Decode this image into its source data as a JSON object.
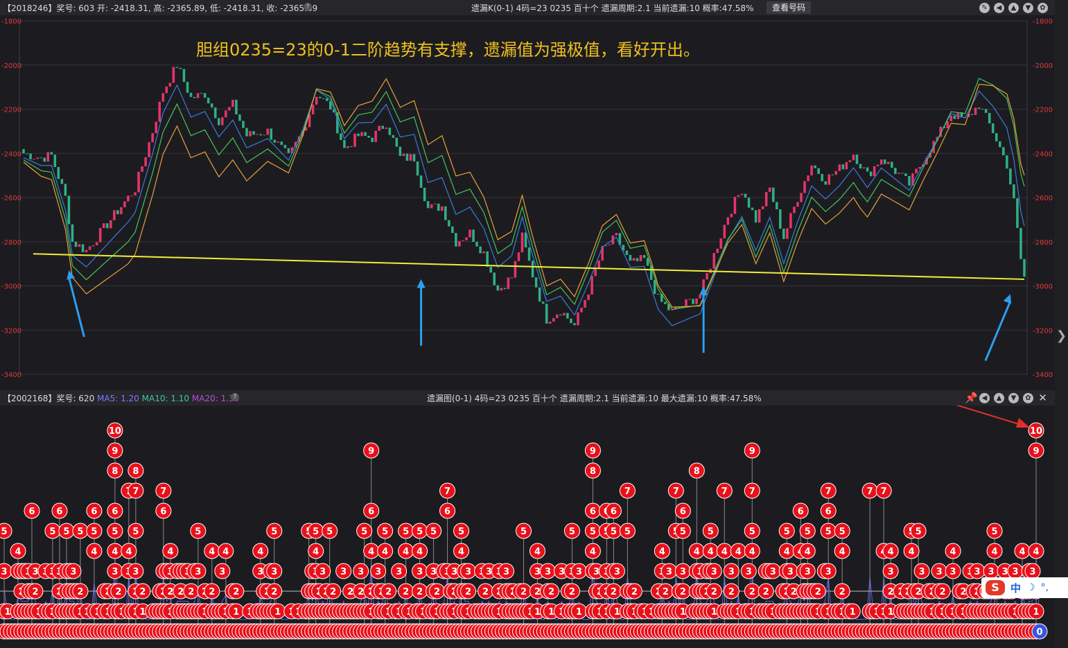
{
  "top_bar": {
    "info_left": "【2018246】奖号: 603  开: -2418.31, 高: -2365.89, 低: -2418.31, 收: -2365.89",
    "info_center": "遗漏K(0-1)  4码=23  0235  百十个  遗漏周期:2.1  当前遗漏:10  概率:47.58%",
    "query_button": "查看号码"
  },
  "bottom_bar": {
    "id_label": "【2002168】奖号: 620",
    "ma5": "MA5: 1.20",
    "ma10": "MA10: 1.10",
    "ma20": "MA20: 1.30",
    "info_center": "遗漏图(0-1)  4码=23  0235  百十个  遗漏周期:2.1  当前遗漏:10  最大遗漏:10  概率:47.58%"
  },
  "annotation": "胆组0235=23的0-1二阶趋势有支撑，遗漏值为强极值，看好开出。",
  "ime": {
    "zh": "中",
    "moon": "☽",
    "punct": "°,"
  },
  "colors": {
    "up": "#e8336b",
    "down": "#2fb084",
    "ma_blue": "#3a7be0",
    "ma_green": "#46c45a",
    "ma_orange": "#e7a23a",
    "support": "#f2ee3a",
    "arrow": "#2aa0f0",
    "red_arrow": "#e0302a",
    "ball": "#e8101a",
    "ball_last": "#3a56e0",
    "title": "#f0c020"
  },
  "chart_data": [
    {
      "type": "candlestick",
      "title": "",
      "ylim": [
        -3400,
        -1800
      ],
      "y_ticks": [
        "-1800",
        "-2000",
        "-2200",
        "-2400",
        "-2600",
        "-2800",
        "-3000",
        "-3200",
        "-3400"
      ],
      "close_path": [
        [
          0,
          -2400
        ],
        [
          5,
          -2420
        ],
        [
          8,
          -2410
        ],
        [
          12,
          -2600
        ],
        [
          14,
          -2800
        ],
        [
          18,
          -2840
        ],
        [
          22,
          -2760
        ],
        [
          28,
          -2640
        ],
        [
          32,
          -2560
        ],
        [
          37,
          -2300
        ],
        [
          40,
          -2120
        ],
        [
          44,
          -2000
        ],
        [
          48,
          -2150
        ],
        [
          52,
          -2130
        ],
        [
          56,
          -2250
        ],
        [
          60,
          -2180
        ],
        [
          64,
          -2320
        ],
        [
          70,
          -2300
        ],
        [
          76,
          -2420
        ],
        [
          80,
          -2300
        ],
        [
          84,
          -2130
        ],
        [
          88,
          -2190
        ],
        [
          92,
          -2380
        ],
        [
          96,
          -2320
        ],
        [
          100,
          -2330
        ],
        [
          104,
          -2260
        ],
        [
          108,
          -2420
        ],
        [
          112,
          -2420
        ],
        [
          116,
          -2650
        ],
        [
          120,
          -2640
        ],
        [
          124,
          -2800
        ],
        [
          128,
          -2760
        ],
        [
          132,
          -2850
        ],
        [
          136,
          -3020
        ],
        [
          140,
          -2960
        ],
        [
          143,
          -2780
        ],
        [
          146,
          -2950
        ],
        [
          150,
          -3150
        ],
        [
          154,
          -3110
        ],
        [
          158,
          -3180
        ],
        [
          162,
          -3020
        ],
        [
          166,
          -2840
        ],
        [
          170,
          -2780
        ],
        [
          174,
          -2900
        ],
        [
          178,
          -2880
        ],
        [
          182,
          -3060
        ],
        [
          186,
          -3120
        ],
        [
          190,
          -3080
        ],
        [
          194,
          -3040
        ],
        [
          198,
          -2860
        ],
        [
          202,
          -2680
        ],
        [
          206,
          -2560
        ],
        [
          210,
          -2700
        ],
        [
          214,
          -2560
        ],
        [
          218,
          -2780
        ],
        [
          222,
          -2600
        ],
        [
          226,
          -2450
        ],
        [
          230,
          -2520
        ],
        [
          234,
          -2470
        ],
        [
          238,
          -2400
        ],
        [
          242,
          -2500
        ],
        [
          246,
          -2420
        ],
        [
          250,
          -2480
        ],
        [
          254,
          -2540
        ],
        [
          258,
          -2430
        ],
        [
          262,
          -2330
        ],
        [
          266,
          -2220
        ],
        [
          270,
          -2250
        ],
        [
          274,
          -2180
        ],
        [
          278,
          -2300
        ],
        [
          282,
          -2450
        ],
        [
          284,
          -2620
        ],
        [
          286,
          -2880
        ],
        [
          287,
          -2960
        ]
      ],
      "moving_averages": [
        {
          "name": "MA5",
          "offsets": [
            [
              0,
              -20
            ],
            [
              30,
              -110
            ],
            [
              60,
              -70
            ],
            [
              90,
              40
            ],
            [
              120,
              130
            ],
            [
              150,
              80
            ],
            [
              180,
              -40
            ],
            [
              210,
              -140
            ],
            [
              240,
              -60
            ],
            [
              270,
              10
            ],
            [
              287,
              230
            ]
          ]
        },
        {
          "name": "MA10",
          "offsets": [
            [
              0,
              -30
            ],
            [
              30,
              -200
            ],
            [
              60,
              -150
            ],
            [
              90,
              60
            ],
            [
              120,
              230
            ],
            [
              150,
              110
            ],
            [
              180,
              60
            ],
            [
              210,
              -170
            ],
            [
              240,
              -130
            ],
            [
              270,
              30
            ],
            [
              287,
              410
            ]
          ]
        },
        {
          "name": "MA20",
          "offsets": [
            [
              0,
              -40
            ],
            [
              30,
              -300
            ],
            [
              60,
              -250
            ],
            [
              90,
              90
            ],
            [
              120,
              320
            ],
            [
              150,
              150
            ],
            [
              180,
              80
            ],
            [
              210,
              -200
            ],
            [
              240,
              -200
            ],
            [
              270,
              -20
            ],
            [
              287,
              460
            ]
          ]
        }
      ],
      "support_line": [
        [
          0,
          -2855
        ],
        [
          287,
          -2970
        ]
      ],
      "arrows_at": [
        13,
        114,
        195,
        283
      ]
    },
    {
      "type": "omission_balls",
      "ylim": [
        0,
        10
      ],
      "labels_in_figure": [
        "0",
        "1",
        "2",
        "3",
        "4",
        "5",
        "6",
        "7",
        "8",
        "9",
        "10"
      ],
      "peaks": [
        [
          0,
          5
        ],
        [
          4,
          4
        ],
        [
          8,
          6
        ],
        [
          14,
          5
        ],
        [
          16,
          6
        ],
        [
          18,
          5
        ],
        [
          22,
          5
        ],
        [
          26,
          6
        ],
        [
          32,
          10
        ],
        [
          36,
          7
        ],
        [
          38,
          8
        ],
        [
          46,
          7
        ],
        [
          48,
          4
        ],
        [
          56,
          5
        ],
        [
          60,
          4
        ],
        [
          64,
          4
        ],
        [
          74,
          4
        ],
        [
          78,
          5
        ],
        [
          88,
          5
        ],
        [
          90,
          5
        ],
        [
          94,
          5
        ],
        [
          104,
          5
        ],
        [
          106,
          9
        ],
        [
          110,
          5
        ],
        [
          116,
          5
        ],
        [
          120,
          5
        ],
        [
          124,
          5
        ],
        [
          128,
          7
        ],
        [
          132,
          5
        ],
        [
          150,
          5
        ],
        [
          154,
          4
        ],
        [
          164,
          5
        ],
        [
          170,
          9
        ],
        [
          174,
          6
        ],
        [
          176,
          6
        ],
        [
          180,
          7
        ],
        [
          190,
          4
        ],
        [
          194,
          7
        ],
        [
          196,
          6
        ],
        [
          200,
          8
        ],
        [
          204,
          5
        ],
        [
          208,
          7
        ],
        [
          212,
          4
        ],
        [
          216,
          9
        ],
        [
          226,
          5
        ],
        [
          230,
          6
        ],
        [
          232,
          5
        ],
        [
          238,
          7
        ],
        [
          242,
          5
        ],
        [
          250,
          7
        ],
        [
          254,
          7
        ],
        [
          256,
          4
        ],
        [
          262,
          5
        ],
        [
          264,
          5
        ],
        [
          274,
          4
        ],
        [
          286,
          5
        ],
        [
          294,
          4
        ],
        [
          298,
          10
        ]
      ],
      "last_value": 10,
      "x_count": 300
    }
  ]
}
